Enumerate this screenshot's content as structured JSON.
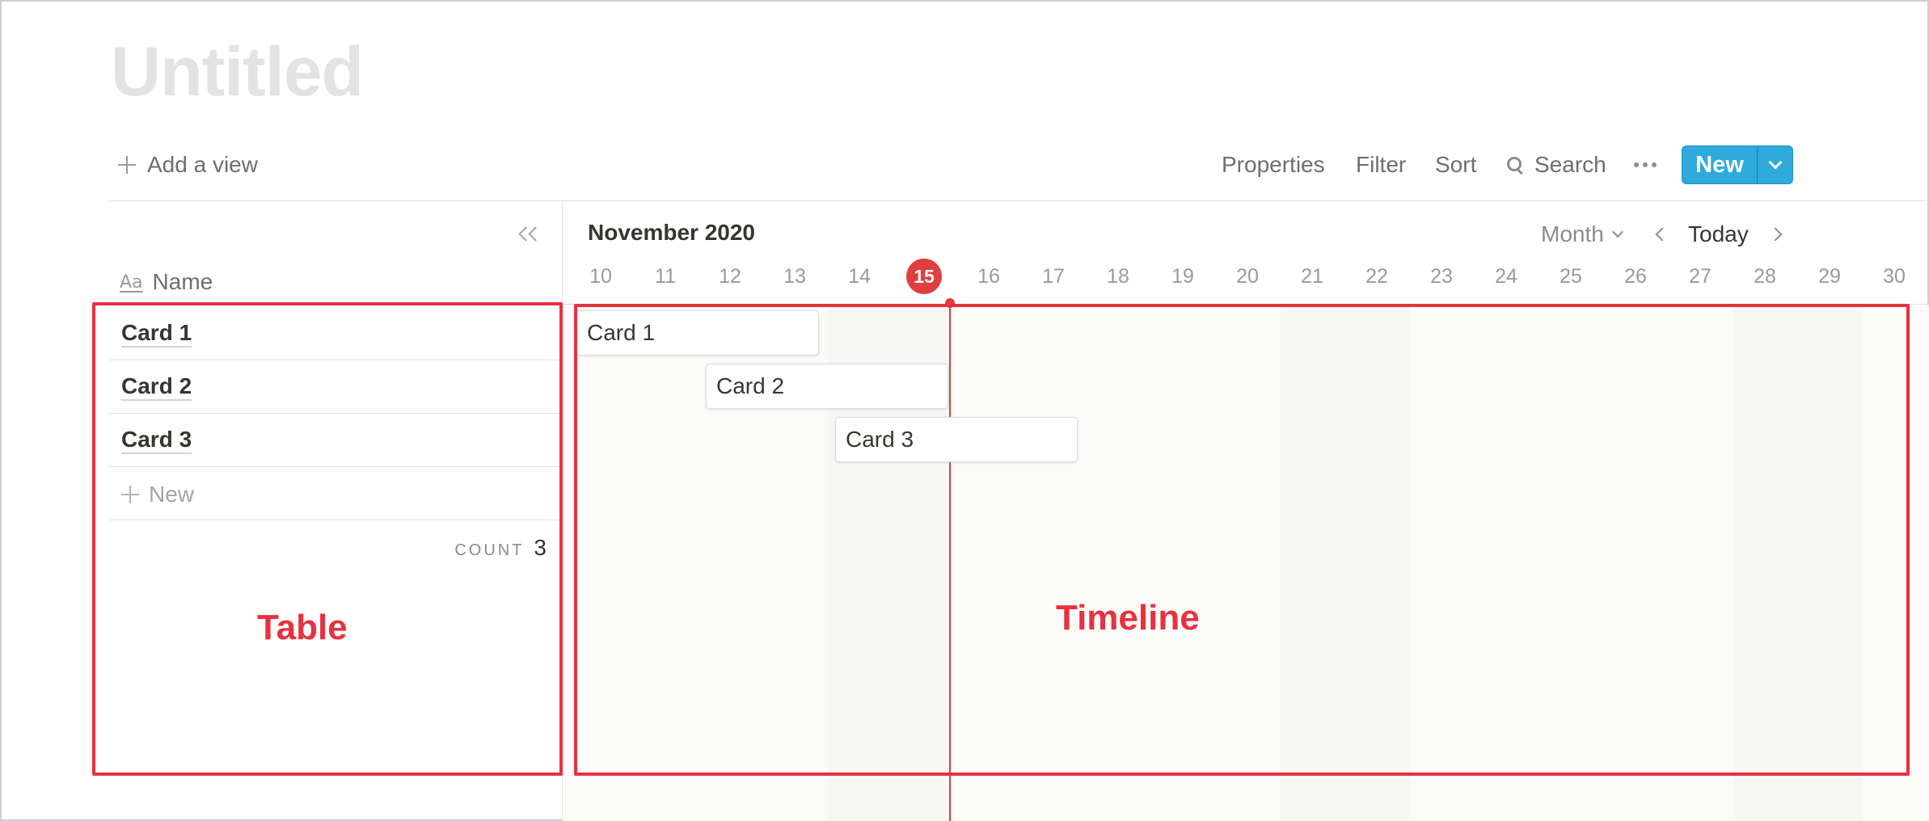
{
  "page": {
    "title": "Untitled"
  },
  "toolbar": {
    "add_view": "Add a view",
    "properties": "Properties",
    "filter": "Filter",
    "sort": "Sort",
    "search": "Search",
    "new": "New",
    "accent_color": "#2eaadc"
  },
  "table": {
    "name_header": "Name",
    "rows": [
      {
        "title": "Card 1"
      },
      {
        "title": "Card 2"
      },
      {
        "title": "Card 3"
      }
    ],
    "new_label": "New",
    "count_label": "COUNT",
    "count_value": "3"
  },
  "timeline": {
    "month_label": "November 2020",
    "scale": "Month",
    "today_label": "Today",
    "current_day": "15",
    "days": [
      "10",
      "11",
      "12",
      "13",
      "14",
      "15",
      "16",
      "17",
      "18",
      "19",
      "20",
      "21",
      "22",
      "23",
      "24",
      "25",
      "26",
      "27",
      "28",
      "29",
      "30"
    ],
    "cards": [
      {
        "title": "Card 1",
        "start": "10",
        "end": "13"
      },
      {
        "title": "Card 2",
        "start": "12",
        "end": "15"
      },
      {
        "title": "Card 3",
        "start": "14",
        "end": "17"
      }
    ],
    "today_color": "#e03e3e"
  },
  "annotations": {
    "table_label": "Table",
    "timeline_label": "Timeline",
    "color": "#e8313f"
  }
}
